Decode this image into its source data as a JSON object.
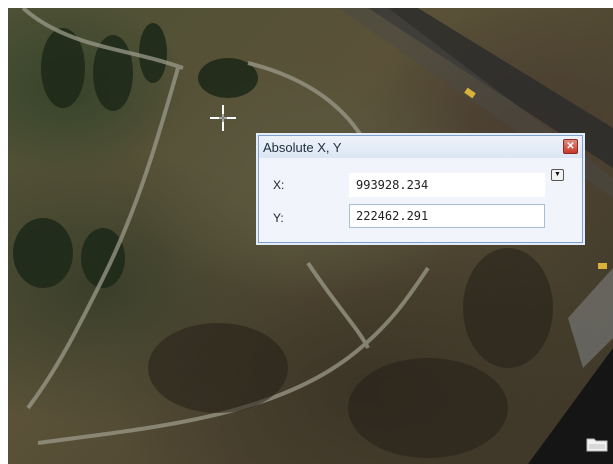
{
  "dialog": {
    "title": "Absolute X, Y",
    "close_icon": "close-icon",
    "x_label": "X:",
    "x_value": "993928.234",
    "y_label": "Y:",
    "y_value": "222462.291",
    "dropdown_icon": "chevron-down-icon"
  },
  "map": {
    "cursor_icon": "crosshair-cursor-icon",
    "corner_icon": "folder-icon"
  }
}
